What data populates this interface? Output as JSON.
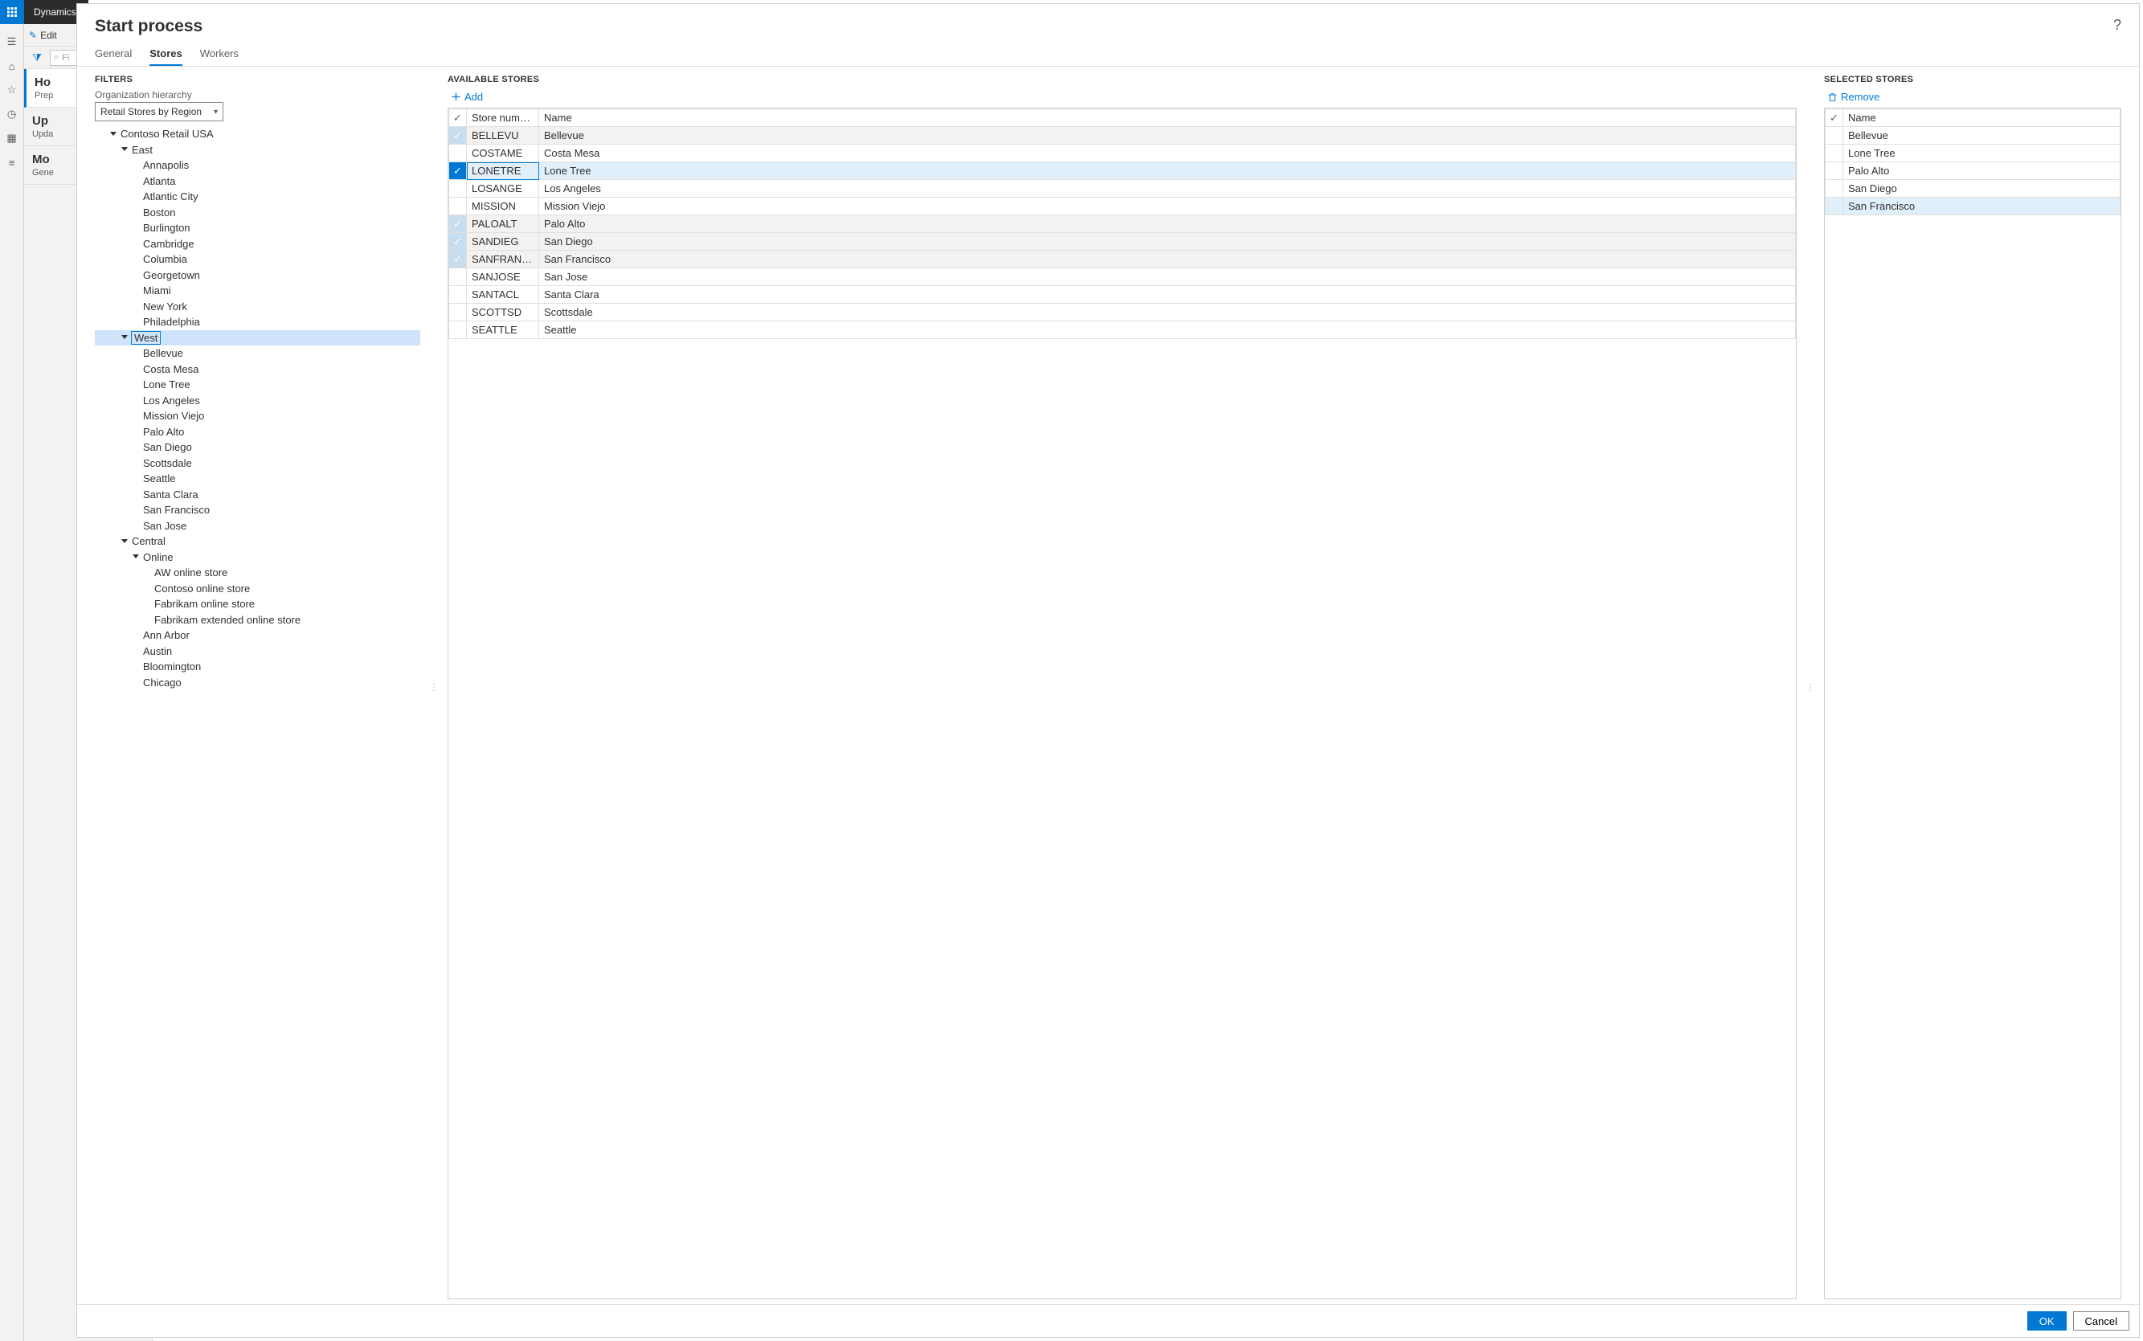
{
  "brand": "Dynamics",
  "backpage": {
    "edit": "Edit",
    "filter_placeholder": "Fi",
    "items": [
      {
        "title": "Ho",
        "sub": "Prep"
      },
      {
        "title": "Up",
        "sub": "Upda"
      },
      {
        "title": "Mo",
        "sub": "Gene"
      }
    ]
  },
  "panel": {
    "title": "Start process",
    "tabs": {
      "general": "General",
      "stores": "Stores",
      "workers": "Workers"
    },
    "filters_label": "FILTERS",
    "org_label": "Organization hierarchy",
    "org_value": "Retail Stores by Region",
    "available_label": "AVAILABLE STORES",
    "selected_label": "SELECTED STORES",
    "add": "Add",
    "remove": "Remove",
    "cols": {
      "store_number": "Store number",
      "name": "Name"
    },
    "ok": "OK",
    "cancel": "Cancel"
  },
  "tree": [
    {
      "d": 1,
      "tw": "▾",
      "label": "Contoso Retail USA"
    },
    {
      "d": 2,
      "tw": "▾",
      "label": "East"
    },
    {
      "d": 3,
      "label": "Annapolis"
    },
    {
      "d": 3,
      "label": "Atlanta"
    },
    {
      "d": 3,
      "label": "Atlantic City"
    },
    {
      "d": 3,
      "label": "Boston"
    },
    {
      "d": 3,
      "label": "Burlington"
    },
    {
      "d": 3,
      "label": "Cambridge"
    },
    {
      "d": 3,
      "label": "Columbia"
    },
    {
      "d": 3,
      "label": "Georgetown"
    },
    {
      "d": 3,
      "label": "Miami"
    },
    {
      "d": 3,
      "label": "New York"
    },
    {
      "d": 3,
      "label": "Philadelphia"
    },
    {
      "d": 2,
      "tw": "▾",
      "label": "West",
      "selected": true
    },
    {
      "d": 3,
      "label": "Bellevue"
    },
    {
      "d": 3,
      "label": "Costa Mesa"
    },
    {
      "d": 3,
      "label": "Lone Tree"
    },
    {
      "d": 3,
      "label": "Los Angeles"
    },
    {
      "d": 3,
      "label": "Mission Viejo"
    },
    {
      "d": 3,
      "label": "Palo Alto"
    },
    {
      "d": 3,
      "label": "San Diego"
    },
    {
      "d": 3,
      "label": "Scottsdale"
    },
    {
      "d": 3,
      "label": "Seattle"
    },
    {
      "d": 3,
      "label": "Santa Clara"
    },
    {
      "d": 3,
      "label": "San Francisco"
    },
    {
      "d": 3,
      "label": "San Jose"
    },
    {
      "d": 2,
      "tw": "▾",
      "label": "Central"
    },
    {
      "d": 3,
      "tw": "▾",
      "label": "Online"
    },
    {
      "d": 4,
      "label": "AW online store"
    },
    {
      "d": 4,
      "label": "Contoso online store"
    },
    {
      "d": 4,
      "label": "Fabrikam online store"
    },
    {
      "d": 4,
      "label": "Fabrikam extended online store"
    },
    {
      "d": 3,
      "label": "Ann Arbor"
    },
    {
      "d": 3,
      "label": "Austin"
    },
    {
      "d": 3,
      "label": "Bloomington"
    },
    {
      "d": 3,
      "label": "Chicago"
    }
  ],
  "available": [
    {
      "num": "BELLEVU",
      "name": "Bellevue",
      "state": "soft"
    },
    {
      "num": "COSTAME",
      "name": "Costa Mesa",
      "state": ""
    },
    {
      "num": "LONETRE",
      "name": "Lone Tree",
      "state": "blue"
    },
    {
      "num": "LOSANGE",
      "name": "Los Angeles",
      "state": ""
    },
    {
      "num": "MISSION",
      "name": "Mission Viejo",
      "state": ""
    },
    {
      "num": "PALOALT",
      "name": "Palo Alto",
      "state": "soft"
    },
    {
      "num": "SANDIEG",
      "name": "San Diego",
      "state": "soft"
    },
    {
      "num": "SANFRANCIS",
      "name": "San Francisco",
      "state": "soft"
    },
    {
      "num": "SANJOSE",
      "name": "San Jose",
      "state": ""
    },
    {
      "num": "SANTACL",
      "name": "Santa Clara",
      "state": ""
    },
    {
      "num": "SCOTTSD",
      "name": "Scottsdale",
      "state": ""
    },
    {
      "num": "SEATTLE",
      "name": "Seattle",
      "state": ""
    }
  ],
  "selected": [
    {
      "name": "Bellevue",
      "hl": false
    },
    {
      "name": "Lone Tree",
      "hl": false
    },
    {
      "name": "Palo Alto",
      "hl": false
    },
    {
      "name": "San Diego",
      "hl": false
    },
    {
      "name": "San Francisco",
      "hl": true
    }
  ]
}
